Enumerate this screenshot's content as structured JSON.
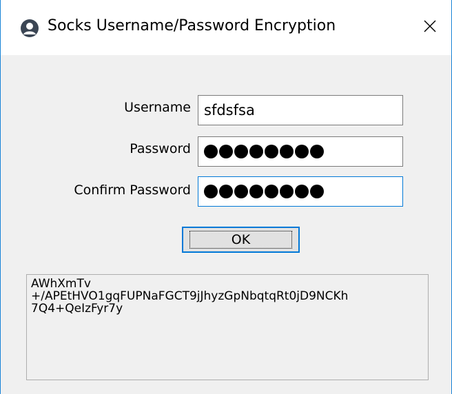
{
  "window": {
    "title": "Socks Username/Password Encryption",
    "app_icon": "user-icon",
    "close_icon": "close-icon",
    "border_color": "#1883d7"
  },
  "form": {
    "username": {
      "label": "Username",
      "value": "sfdsfsa"
    },
    "password": {
      "label": "Password",
      "masked_length": 8
    },
    "confirm_password": {
      "label": "Confirm Password",
      "masked_length": 8
    },
    "ok_button_label": "OK"
  },
  "output": {
    "lines": [
      "AWhXmTv",
      "+/APEtHVO1gqFUPNaFGCT9jJhyzGpNbqtqRt0jD9NCKh",
      "7Q4+QeIzFyr7y"
    ]
  },
  "colors": {
    "accent": "#0078d7",
    "dialog_bg": "#f0f0f0"
  }
}
